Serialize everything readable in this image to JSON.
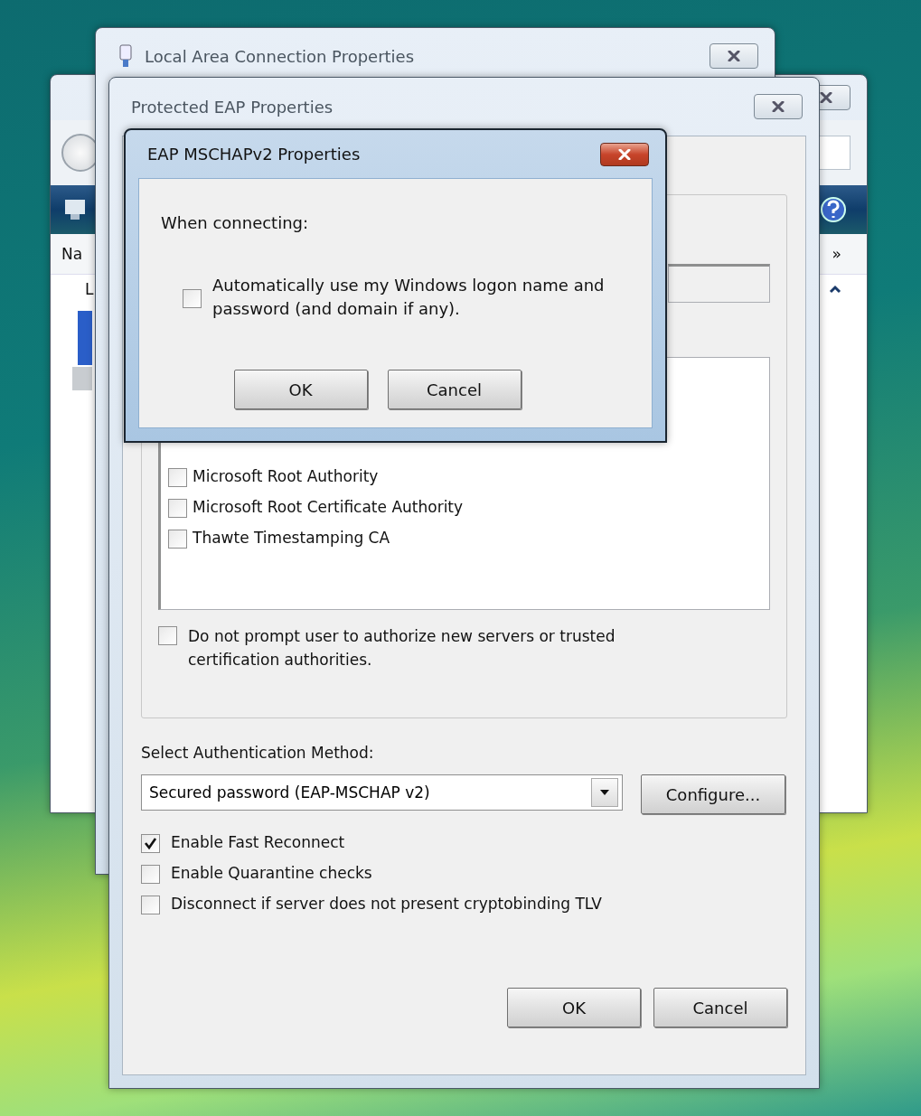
{
  "background_window": {
    "column_header": "Na",
    "list_group": "L",
    "more_chevron": "»"
  },
  "connection_window": {
    "title": "Local Area Connection Properties"
  },
  "peap_window": {
    "title": "Protected EAP Properties",
    "certificates": [
      {
        "label": "Microsoft Root Authority",
        "checked": false
      },
      {
        "label": "Microsoft Root Certificate Authority",
        "checked": false
      },
      {
        "label": "Thawte Timestamping CA",
        "checked": false
      }
    ],
    "no_prompt": {
      "label": "Do not prompt user to authorize new servers or trusted certification authorities.",
      "checked": false
    },
    "auth_method_label": "Select Authentication Method:",
    "auth_method": {
      "value": "Secured password (EAP-MSCHAP v2)"
    },
    "configure_button": "Configure...",
    "options": [
      {
        "label": "Enable Fast Reconnect",
        "checked": true
      },
      {
        "label": "Enable Quarantine checks",
        "checked": false
      },
      {
        "label": "Disconnect if server does not present cryptobinding TLV",
        "checked": false
      }
    ],
    "buttons": [
      "OK",
      "Cancel"
    ]
  },
  "mschap_dialog": {
    "title": "EAP MSCHAPv2 Properties",
    "prompt": "When connecting:",
    "auto_logon": {
      "label": "Automatically use my Windows logon name and password (and domain if any).",
      "checked": false
    },
    "buttons": [
      "OK",
      "Cancel"
    ]
  }
}
